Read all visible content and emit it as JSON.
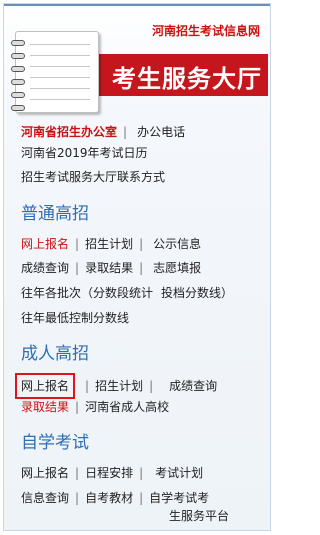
{
  "header": {
    "site_name": "河南招生考试信息网",
    "banner_title": "考生服务大厅"
  },
  "office": {
    "name": "河南省招生办公室",
    "phone": "办公电话",
    "calendar": "河南省2019年考试日历",
    "contact": "招生考试服务大厅联系方式"
  },
  "general": {
    "title": "普通高招",
    "row1": [
      "网上报名",
      "招生计划",
      "公示信息"
    ],
    "row2": [
      "成绩查询",
      "录取结果",
      "志愿填报"
    ],
    "row3": [
      "往年各批次（分数段统计",
      "投档分数线）"
    ],
    "row4": "往年最低控制分数线"
  },
  "adult": {
    "title": "成人高招",
    "row1": [
      "网上报名",
      "招生计划",
      "成绩查询"
    ],
    "row2": [
      "录取结果",
      "河南省成人高校"
    ]
  },
  "self_study": {
    "title": "自学考试",
    "row1": [
      "网上报名",
      "日程安排",
      "考试计划"
    ],
    "row2": [
      "信息查询",
      "自考教材",
      "自学考试考",
      "生服务平台"
    ]
  },
  "colors": {
    "brand_red": "#cc1111",
    "section_blue": "#2f6eb5",
    "highlight": "#e0141e"
  }
}
